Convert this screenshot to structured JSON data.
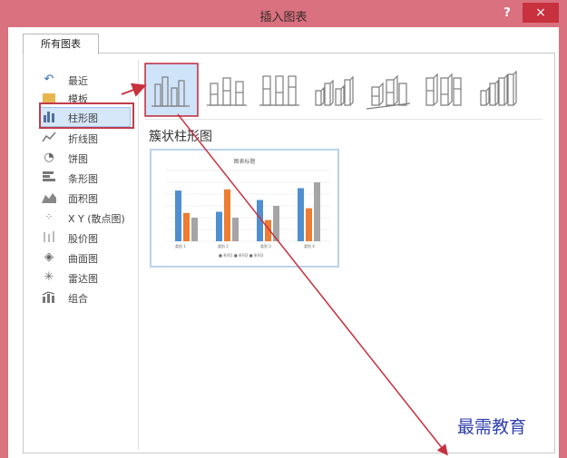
{
  "window": {
    "title": "插入图表",
    "help": "?",
    "close": "×"
  },
  "tab": {
    "label": "所有图表"
  },
  "sidebar": {
    "items": [
      {
        "label": "最近",
        "icon": "undo-icon"
      },
      {
        "label": "模板",
        "icon": "folder-icon"
      },
      {
        "label": "柱形图",
        "icon": "column-chart-icon",
        "selected": true
      },
      {
        "label": "折线图",
        "icon": "line-chart-icon"
      },
      {
        "label": "饼图",
        "icon": "pie-chart-icon"
      },
      {
        "label": "条形图",
        "icon": "bar-chart-icon"
      },
      {
        "label": "面积图",
        "icon": "area-chart-icon"
      },
      {
        "label": "X Y (散点图)",
        "icon": "scatter-chart-icon"
      },
      {
        "label": "股价图",
        "icon": "stock-chart-icon"
      },
      {
        "label": "曲面图",
        "icon": "surface-chart-icon"
      },
      {
        "label": "雷达图",
        "icon": "radar-chart-icon"
      },
      {
        "label": "组合",
        "icon": "combo-chart-icon"
      }
    ]
  },
  "chart_types": [
    "clustered-column-icon",
    "stacked-column-icon",
    "100-stacked-column-icon",
    "3d-clustered-column-icon",
    "3d-stacked-column-icon",
    "3d-100-stacked-column-icon",
    "3d-column-icon"
  ],
  "subtype": {
    "heading": "簇状柱形图"
  },
  "preview": {
    "title": "图表标题",
    "colors": {
      "series1": "#4f8fd0",
      "series2": "#ed7d31",
      "series3": "#a5a5a5"
    },
    "chart_data": {
      "type": "bar",
      "categories": [
        "类别 1",
        "类别 2",
        "类别 3",
        "类别 4"
      ],
      "series": [
        {
          "name": "系列1",
          "values": [
            4.3,
            2.5,
            3.5,
            4.5
          ]
        },
        {
          "name": "系列2",
          "values": [
            2.4,
            4.4,
            1.8,
            2.8
          ]
        },
        {
          "name": "系列3",
          "values": [
            2,
            2,
            3,
            5
          ]
        }
      ],
      "ylim": [
        0,
        6
      ],
      "grid": true,
      "legend": "bottom"
    },
    "legend_text": "■ 系列1  ■ 系列2  ■ 系列3"
  },
  "watermark": "最需教育"
}
